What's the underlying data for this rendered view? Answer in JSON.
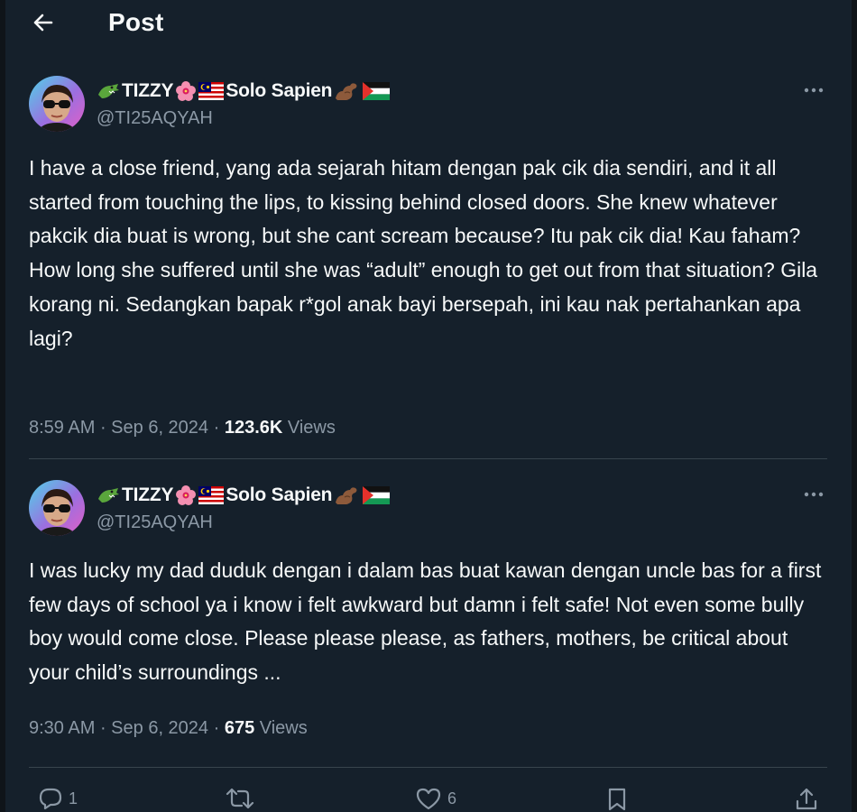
{
  "header": {
    "title": "Post"
  },
  "posts": [
    {
      "author": {
        "name": "TIZZY",
        "name_suffix": "Solo Sapien",
        "handle": "@TI25AQYAH",
        "emojis": [
          "crocodile-emoji",
          "hibiscus-emoji",
          "malaysia-flag-emoji",
          "flexed-biceps-emoji",
          "palestine-flag-emoji"
        ]
      },
      "text": "I have a close friend, yang ada sejarah hitam dengan pak cik dia sendiri, and it all started from touching the lips, to kissing behind closed doors. She knew whatever pakcik dia buat is wrong, but she cant scream because? Itu pak cik dia! Kau faham? How long she suffered until she was “adult” enough to get out from that situation? Gila korang ni. Sedangkan bapak r*gol anak bayi bersepah, ini kau nak pertahankan apa lagi?",
      "time": "8:59 AM",
      "sep1": " · ",
      "date": "Sep 6, 2024",
      "sep2": " · ",
      "views": "123.6K",
      "views_label": " Views"
    },
    {
      "author": {
        "name": "TIZZY",
        "name_suffix": "Solo Sapien",
        "handle": "@TI25AQYAH",
        "emojis": [
          "crocodile-emoji",
          "hibiscus-emoji",
          "malaysia-flag-emoji",
          "flexed-biceps-emoji",
          "palestine-flag-emoji"
        ]
      },
      "text": "I was lucky my dad duduk dengan i dalam bas buat kawan dengan uncle bas for a first few days of school ya i know i felt awkward but damn i felt safe! Not even some bully boy would come close. Please please please, as fathers, mothers, be critical about your child’s surroundings ...",
      "time": "9:30 AM",
      "sep1": " · ",
      "date": "Sep 6, 2024",
      "sep2": " · ",
      "views": "675",
      "views_label": " Views"
    }
  ],
  "actions": {
    "reply_count": "1",
    "repost_count": "",
    "like_count": "6",
    "icons": [
      "reply-icon",
      "repost-icon",
      "like-icon",
      "bookmark-icon",
      "share-icon"
    ]
  },
  "colors": {
    "background": "#15202b",
    "text_primary": "#f7f9f9",
    "text_secondary": "#8b98a5",
    "divider": "#38444d"
  }
}
